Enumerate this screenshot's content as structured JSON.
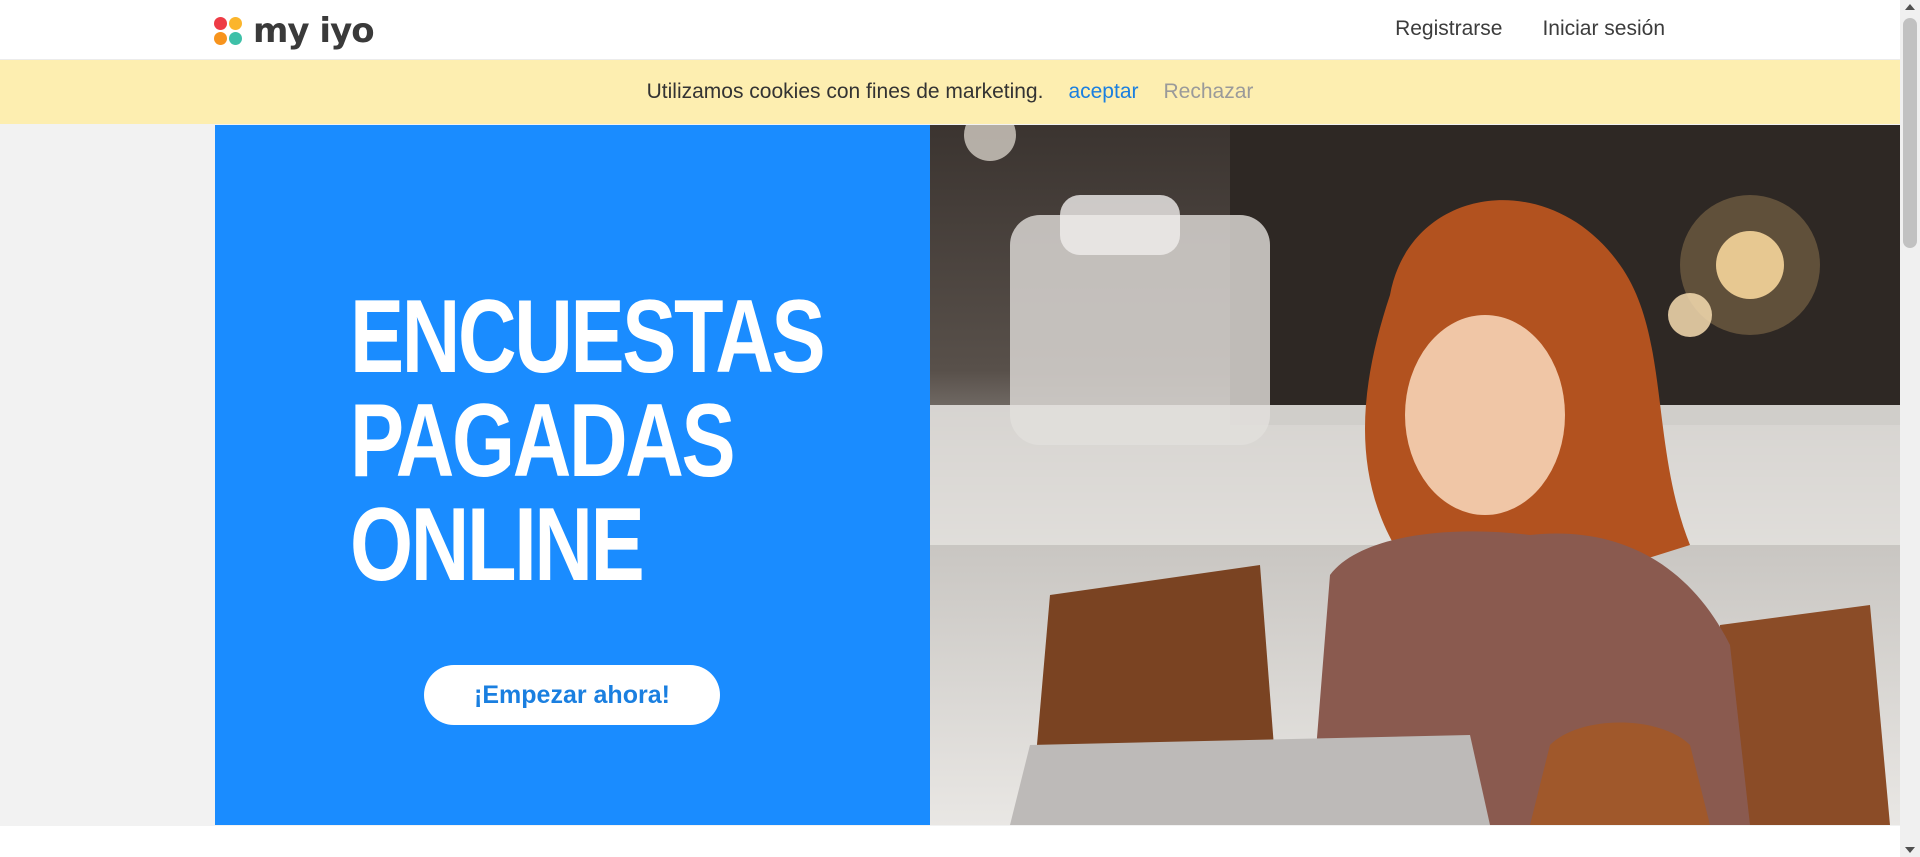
{
  "header": {
    "logo_text": "my iyo",
    "nav": {
      "register_label": "Registrarse",
      "login_label": "Iniciar sesión"
    }
  },
  "cookie_banner": {
    "message": "Utilizamos cookies con fines de marketing.",
    "accept_label": "aceptar",
    "reject_label": "Rechazar"
  },
  "hero": {
    "headline_lines": [
      "ENCUESTAS",
      "PAGADAS",
      "ONLINE"
    ],
    "cta_label": "¡Empezar ahora!",
    "image_icon": "photo-woman-laptop-cafe"
  },
  "colors": {
    "brand_blue": "#1a8cff",
    "cookie_bg": "#fdeeb0",
    "link_blue": "#1a7fe0"
  }
}
